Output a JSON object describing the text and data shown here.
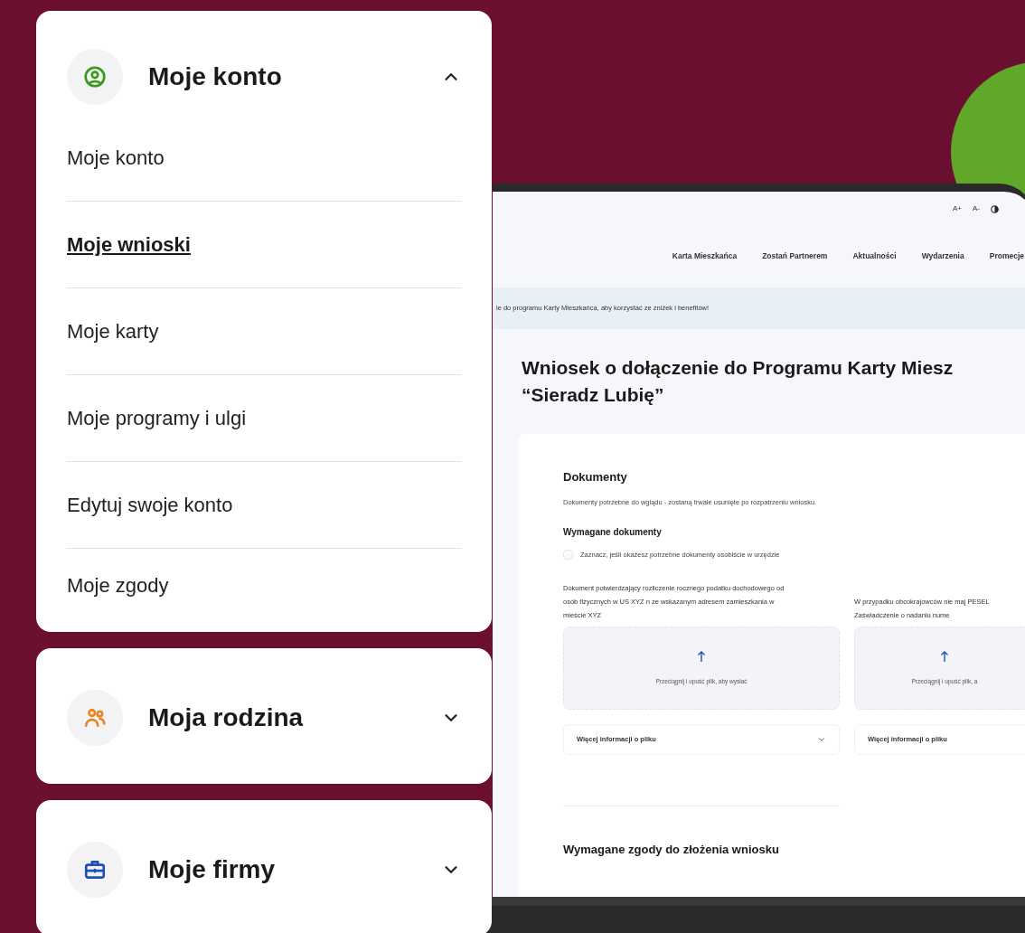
{
  "account_menu": {
    "sections": [
      {
        "title": "Moje konto",
        "kind": "user",
        "color": "#3a9a1a",
        "expanded": true,
        "items": [
          {
            "label": "Moje konto",
            "selected": false
          },
          {
            "label": "Moje wnioski",
            "selected": true
          },
          {
            "label": "Moje karty",
            "selected": false
          },
          {
            "label": "Moje programy i ulgi",
            "selected": false
          },
          {
            "label": "Edytuj swoje konto",
            "selected": false
          },
          {
            "label": "Moje zgody",
            "selected": false
          }
        ]
      },
      {
        "title": "Moja rodzina",
        "kind": "family",
        "color": "#e8831f",
        "expanded": false
      },
      {
        "title": "Moje firmy",
        "kind": "briefcase",
        "color": "#1f4fb5",
        "expanded": false
      }
    ]
  },
  "tablet": {
    "accessibility": [
      "A+",
      "A-"
    ],
    "nav": [
      "Karta Mieszkańca",
      "Zostań Partnerem",
      "Aktualności",
      "Wydarzenia",
      "Promecje"
    ],
    "banner": "le do programu Karty Mieszkańca, aby korzystać ze zniżek i benefitów!",
    "heading": "Wniosek o dołączenie do Programu Karty Miesz",
    "heading_line2": "“Sieradz Lubię”",
    "section_title": "Dokumenty",
    "section_text": "Dokumenty potrzebne do wglądu - zostaną trwale usunięte po rozpatrzeniu wniosku.",
    "required_title": "Wymagane dokumenty",
    "checkbox": {
      "label": "Zaznacz, jeśli okażesz potrzebne dokumenty osobiście w urzędzie",
      "checked": false
    },
    "documents": [
      {
        "description": "Dokument potwierdzający rozliczenie rocznego podatku dochodowego od osób fizycznych w US XYZ n ze wskazanym adresem zamieszkania w mieście XYZ",
        "upload_hint": "Przeciągnij i upuść plik, aby wysłać",
        "more_info": "Więcej informacji o pliku"
      },
      {
        "description": "W przypadku obcokrajowców nie maj PESEL Zaświadczenie o nadaniu nume",
        "upload_hint": "Przeciągnij i upuść plik, a",
        "more_info": "Więcej informacji o pliku"
      }
    ],
    "consents_title": "Wymagane zgody do złożenia wniosku"
  }
}
